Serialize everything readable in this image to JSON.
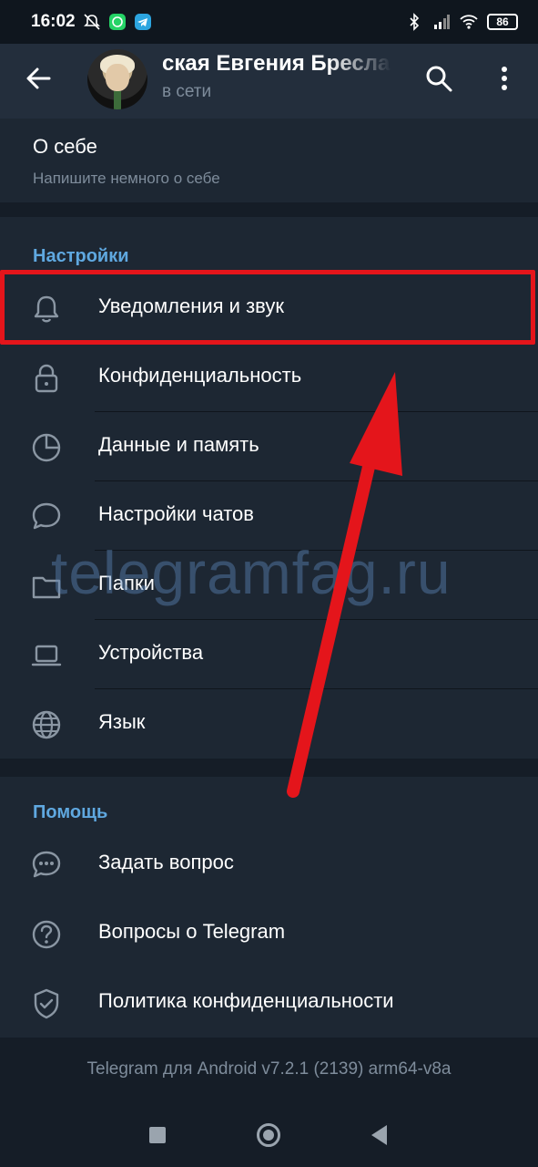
{
  "status_bar": {
    "time": "16:02",
    "battery": "86",
    "icons": [
      "mute-icon",
      "whatsapp-icon",
      "telegram-icon",
      "bluetooth-icon",
      "signal-icon",
      "wifi-icon"
    ]
  },
  "header": {
    "name": "ская   Евгения Бресла",
    "status": "в сети",
    "icons": [
      "back-arrow-icon",
      "search-icon",
      "more-vert-icon"
    ]
  },
  "about": {
    "title": "О себе",
    "hint": "Напишите немного о себе"
  },
  "settings_section": {
    "title": "Настройки",
    "items": [
      {
        "label": "Уведомления и звук",
        "icon": "bell-icon"
      },
      {
        "label": "Конфиденциальность",
        "icon": "lock-icon"
      },
      {
        "label": "Данные и память",
        "icon": "clock-pie-icon"
      },
      {
        "label": "Настройки чатов",
        "icon": "chat-bubble-icon"
      },
      {
        "label": "Папки",
        "icon": "folder-icon"
      },
      {
        "label": "Устройства",
        "icon": "laptop-icon"
      },
      {
        "label": "Язык",
        "icon": "globe-icon"
      }
    ]
  },
  "help_section": {
    "title": "Помощь",
    "items": [
      {
        "label": "Задать вопрос",
        "icon": "chat-dots-icon"
      },
      {
        "label": "Вопросы о Telegram",
        "icon": "question-icon"
      },
      {
        "label": "Политика конфиденциальности",
        "icon": "shield-check-icon"
      }
    ]
  },
  "watermark": "telegramfag.ru",
  "version": "Telegram для Android v7.2.1 (2139) arm64-v8a",
  "colors": {
    "background": "#1d2733",
    "header": "#232e3c",
    "section_title": "#5fa8e0",
    "highlight": "#e4151b",
    "secondary_text": "#7e8c9b"
  }
}
